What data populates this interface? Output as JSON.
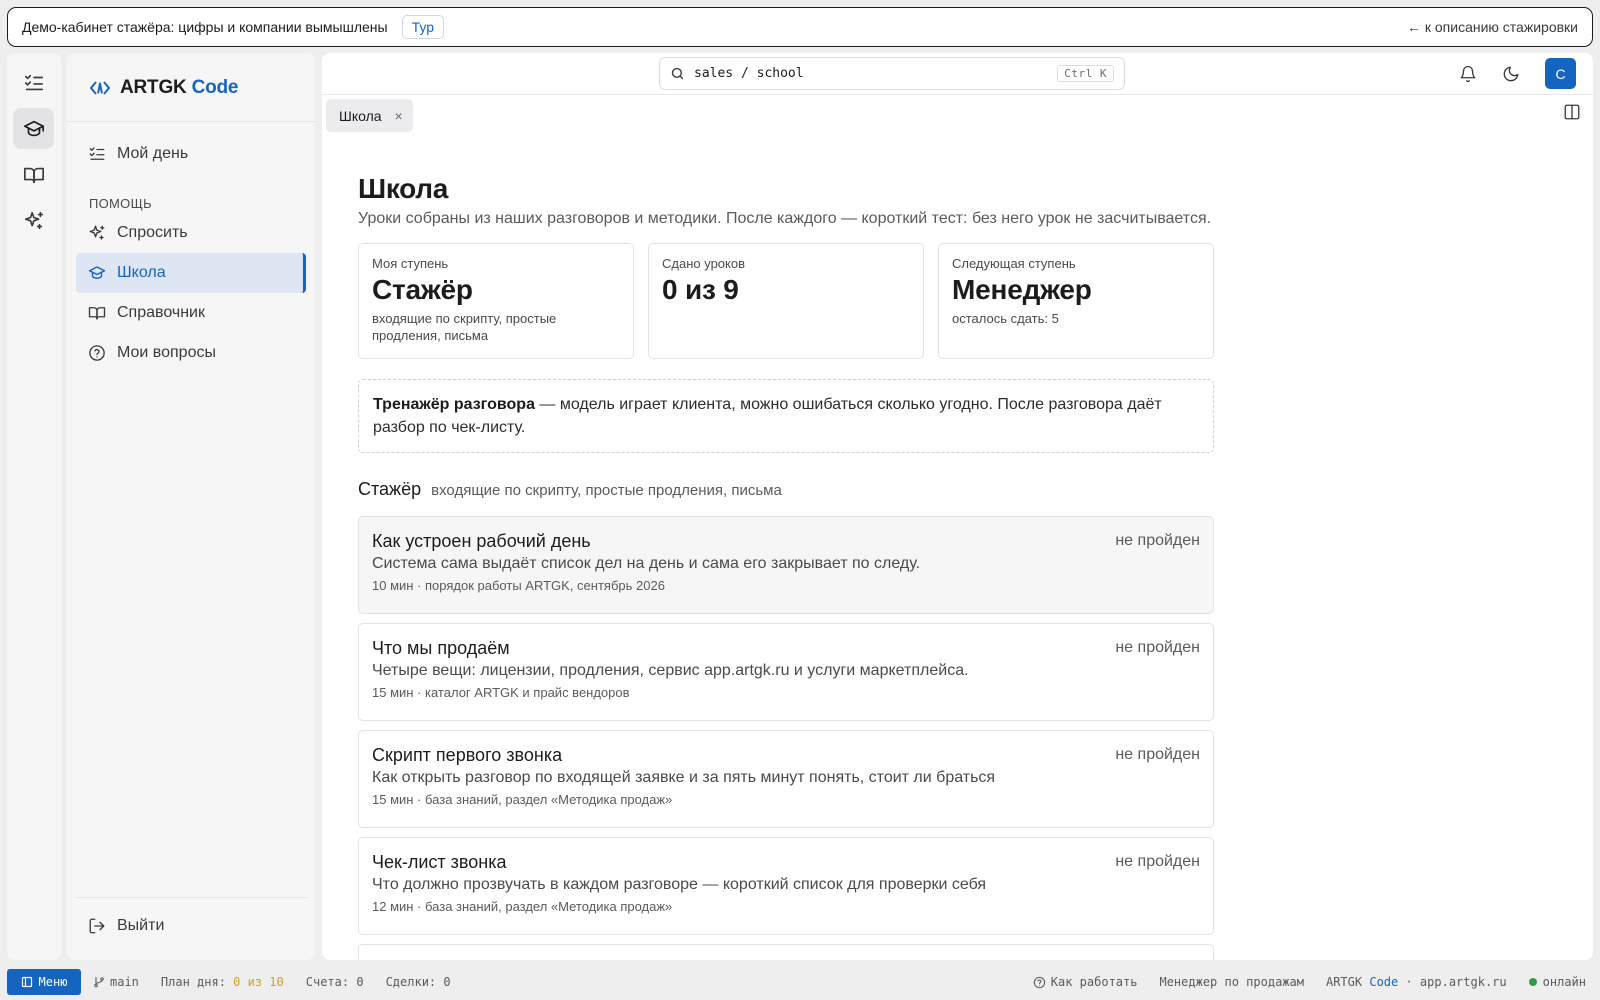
{
  "banner": {
    "text": "Демо-кабинет стажёра: цифры и компании вымышлены",
    "tour_label": "Тур",
    "back_label": "← к описанию стажировки"
  },
  "rail": {
    "icons": [
      "checklist-icon",
      "graduation-cap-icon",
      "book-icon",
      "sparkles-icon"
    ],
    "active": "graduation-cap-icon"
  },
  "brand": {
    "name": "ARTGK",
    "accent": "Code"
  },
  "sidebar": {
    "my_day": "Мой день",
    "section_help": "ПОМОЩЬ",
    "items": [
      {
        "label": "Спросить",
        "icon": "sparkles-icon"
      },
      {
        "label": "Школа",
        "icon": "graduation-cap-icon",
        "active": true
      },
      {
        "label": "Справочник",
        "icon": "book-icon"
      },
      {
        "label": "Мои вопросы",
        "icon": "question-circle-icon"
      }
    ],
    "logout": "Выйти"
  },
  "topbar": {
    "search_value": "sales / school",
    "search_shortcut": "Ctrl K",
    "avatar_letter": "С"
  },
  "tab": {
    "label": "Школа",
    "close": "×"
  },
  "page": {
    "title": "Школа",
    "subtitle": "Уроки собраны из наших разговоров и методики. После каждого — короткий тест: без него урок не засчитывается."
  },
  "stats": [
    {
      "label": "Моя ступень",
      "value": "Стажёр",
      "note": "входящие по скрипту, простые продления, письма"
    },
    {
      "label": "Сдано уроков",
      "value": "0 из 9",
      "note": ""
    },
    {
      "label": "Следующая ступень",
      "value": "Менеджер",
      "note": "осталось сдать: 5"
    }
  ],
  "trainer": {
    "title": "Тренажёр разговора",
    "text": " — модель играет клиента, можно ошибаться сколько угодно. После разговора даёт разбор по чек-листу."
  },
  "level": {
    "name": "Стажёр",
    "desc": "входящие по скрипту, простые продления, письма"
  },
  "lessons": [
    {
      "title": "Как устроен рабочий день",
      "desc": "Система сама выдаёт список дел на день и сама его закрывает по следу.",
      "meta": "10 мин · порядок работы ARTGK, сентябрь 2026",
      "status": "не пройден"
    },
    {
      "title": "Что мы продаём",
      "desc": "Четыре вещи: лицензии, продления, сервис app.artgk.ru и услуги маркетплейса.",
      "meta": "15 мин · каталог ARTGK и прайс вендоров",
      "status": "не пройден"
    },
    {
      "title": "Скрипт первого звонка",
      "desc": "Как открыть разговор по входящей заявке и за пять минут понять, стоит ли браться",
      "meta": "15 мин · база знаний, раздел «Методика продаж»",
      "status": "не пройден"
    },
    {
      "title": "Чек-лист звонка",
      "desc": "Что должно прозвучать в каждом разговоре — короткий список для проверки себя",
      "meta": "12 мин · база знаний, раздел «Методика продаж»",
      "status": "не пройден"
    }
  ],
  "statusbar": {
    "menu": "Меню",
    "branch": "main",
    "plan_label": "План дня:",
    "plan_value": "0 из 10",
    "invoices_label": "Счета:",
    "invoices_value": "0",
    "deals_label": "Сделки:",
    "deals_value": "0",
    "how_to": "Как работать",
    "role": "Менеджер по продажам",
    "brand_name": "ARTGK",
    "brand_accent": "Code",
    "domain": "· app.artgk.ru",
    "online": "онлайн"
  },
  "colors": {
    "accent": "#1565c0",
    "status_value": "#d4a017",
    "online": "#2e9b47"
  }
}
